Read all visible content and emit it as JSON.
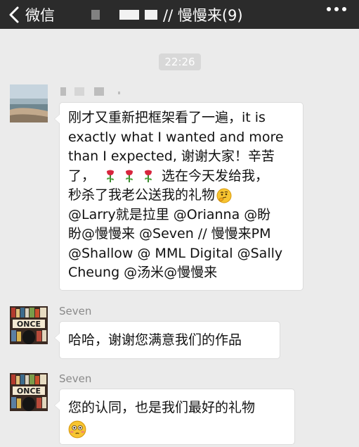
{
  "header": {
    "back_label": "微信",
    "title": "// 慢慢来(9)"
  },
  "time_divider": "22:26",
  "messages": [
    {
      "sender": "",
      "lines": [
        "刚才又重新把框架看了一遍，it is",
        "exactly what I wanted and more",
        "than I expected, 谢谢大家！辛苦",
        "了，",
        "选在今天发给我，",
        "秒杀了我老公送我的礼物",
        "@Larry就是拉里 @Orianna @盼",
        "盼@慢慢来 @Seven // 慢慢来PM",
        "@Shallow @ MML Digital @Sally",
        "Cheung @汤米@慢慢来"
      ]
    },
    {
      "sender": "Seven",
      "text": "哈哈，谢谢您满意我们的作品"
    },
    {
      "sender": "Seven",
      "text": "您的认同，也是我们最好的礼物"
    }
  ],
  "icons": {
    "back": "chevron-left-icon",
    "more": "more-dots-icon",
    "rose": "rose-emoji-icon",
    "thinking": "thinking-face-emoji-icon",
    "flushed": "flushed-face-emoji-icon"
  },
  "colors": {
    "header_bg": "#2b2b2b",
    "chat_bg": "#ebebeb",
    "bubble_bg": "#ffffff",
    "time_chip_bg": "#d8d8d8"
  }
}
